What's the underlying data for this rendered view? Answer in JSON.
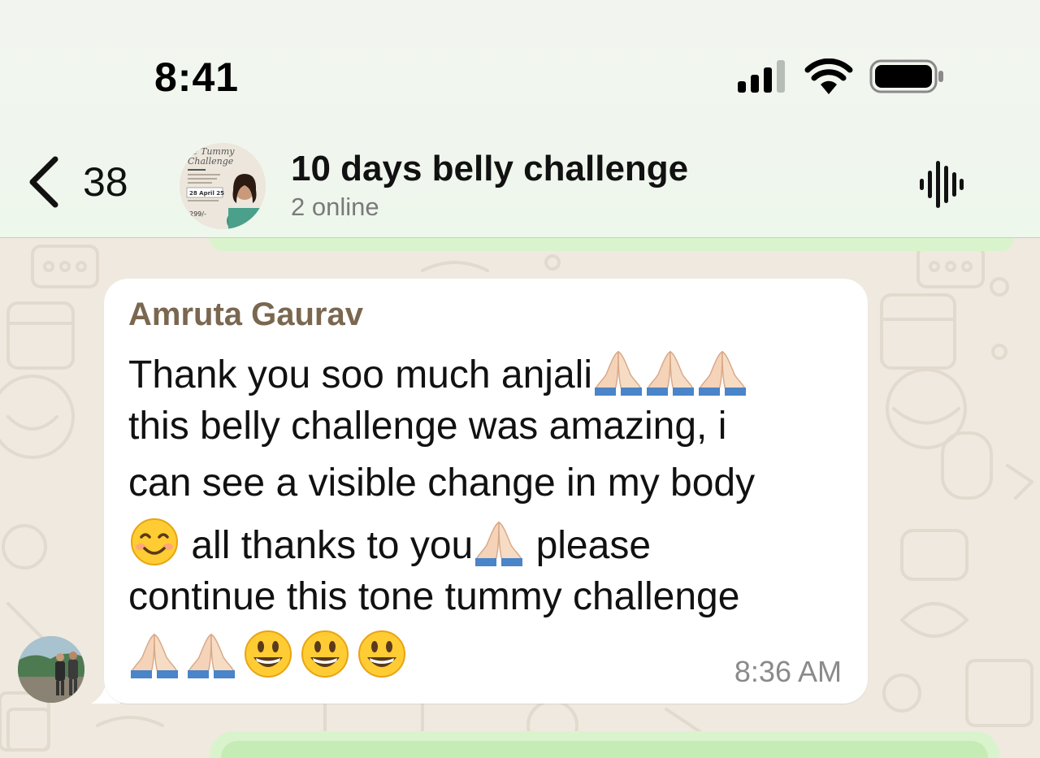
{
  "status_bar": {
    "time": "8:41",
    "icons": [
      "cellular-signal-icon",
      "wifi-icon",
      "battery-icon"
    ]
  },
  "header": {
    "back_count": "38",
    "title": "10 days belly challenge",
    "subtitle": "2 online",
    "avatar_text": {
      "line1": "e Tummy",
      "line2": "Challenge",
      "date": "28 April 25",
      "price": "299/-"
    },
    "icons": [
      "back-chevron-icon",
      "voice-waveform-icon"
    ]
  },
  "message": {
    "sender": "Amruta Gaurav",
    "lines": [
      "Thank you soo much anjali",
      "this belly challenge was amazing, i",
      "can see a visible change in my body",
      "all thanks to you",
      "please",
      "continue this tone tummy challenge"
    ],
    "time": "8:36 AM",
    "emoji": [
      "folded-hands",
      "smiling-face",
      "grinning-face"
    ]
  },
  "colors": {
    "header_bg": "#f0f6ee",
    "wallpaper": "#efe9df",
    "bubble_incoming": "#ffffff",
    "bubble_outgoing": "#d9f4cc",
    "sender_name": "#7a6750",
    "time_text": "#8a8a8a"
  }
}
